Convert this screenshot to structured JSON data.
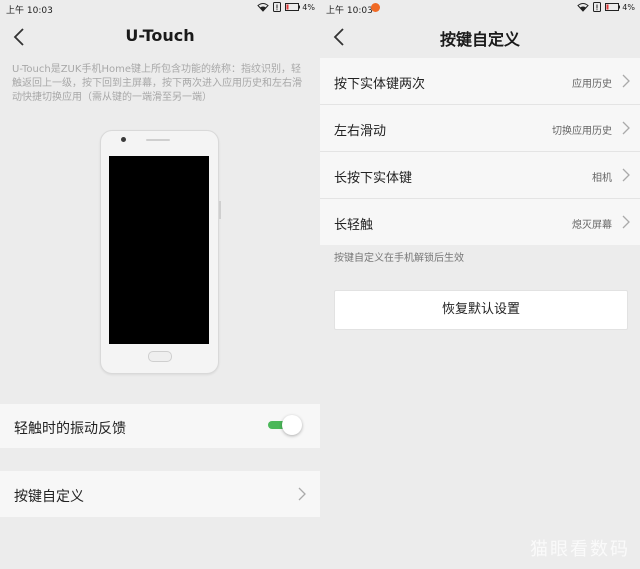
{
  "left": {
    "status": {
      "time": "上午 10:03",
      "battery": "4%"
    },
    "title": "U-Touch",
    "description": "U-Touch是ZUK手机Home键上所包含功能的统称：指纹识别，轻触返回上一级，按下回到主屏幕，按下两次进入应用历史和左右滑动快捷切换应用（需从键的一端滑至另一端）",
    "vibration_label": "轻触时的振动反馈",
    "vibration_enabled": true,
    "custom_keys_label": "按键自定义"
  },
  "right": {
    "status": {
      "time": "上午 10:03",
      "battery": "4%"
    },
    "title": "按键自定义",
    "items": [
      {
        "label": "按下实体键两次",
        "value": "应用历史"
      },
      {
        "label": "左右滑动",
        "value": "切换应用历史"
      },
      {
        "label": "长按下实体键",
        "value": "相机"
      },
      {
        "label": "长轻触",
        "value": "熄灭屏幕"
      }
    ],
    "note": "按键自定义在手机解锁后生效",
    "reset_label": "恢复默认设置"
  },
  "watermark": "猫眼看数码",
  "colors": {
    "toggle_on": "#4cb85a",
    "notification": "#f06a25",
    "background": "#ececec"
  }
}
